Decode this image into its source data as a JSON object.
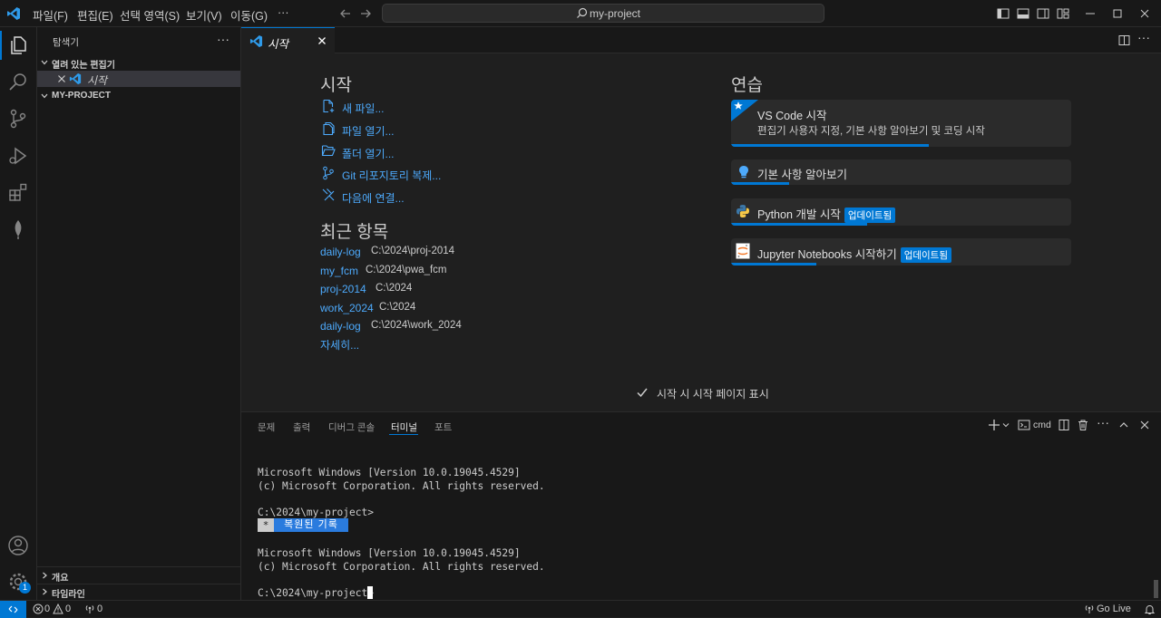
{
  "titlebar": {
    "menus": [
      "파일(F)",
      "편집(E)",
      "선택 영역(S)",
      "보기(V)",
      "이동(G)",
      "···"
    ],
    "command_center": "my-project"
  },
  "sidebar": {
    "title": "탐색기",
    "open_editors_label": "열려 있는 편집기",
    "open_editor_item": "시작",
    "project_label": "MY-PROJECT",
    "outline_label": "개요",
    "timeline_label": "타임라인"
  },
  "tabs": [
    {
      "label": "시작"
    }
  ],
  "welcome": {
    "start_heading": "시작",
    "start_links": [
      "새 파일...",
      "파일 열기...",
      "폴더 열기...",
      "Git 리포지토리 복제...",
      "다음에 연결..."
    ],
    "recent_heading": "최근 항목",
    "recent": [
      {
        "name": "daily-log",
        "path": "C:\\2024\\proj-2014"
      },
      {
        "name": "my_fcm",
        "path": "C:\\2024\\pwa_fcm"
      },
      {
        "name": "proj-2014",
        "path": "C:\\2024"
      },
      {
        "name": "work_2024",
        "path": "C:\\2024"
      },
      {
        "name": "daily-log",
        "path": "C:\\2024\\work_2024"
      }
    ],
    "more_link": "자세히...",
    "walkthrough_heading": "연습",
    "walkthroughs": [
      {
        "title": "VS Code 시작",
        "description": "편집기 사용자 지정, 기본 사항 알아보기 및 코딩 시작",
        "progress": 0.58
      },
      {
        "title": "기본 사항 알아보기",
        "progress": 0.17
      },
      {
        "title": "Python 개발 시작",
        "badge": "업데이트됨",
        "progress": 0.4
      },
      {
        "title": "Jupyter Notebooks 시작하기",
        "badge": "업데이트됨",
        "progress": 0.25
      }
    ],
    "show_on_startup": "시작 시 시작 페이지 표시"
  },
  "panel": {
    "tabs": [
      "문제",
      "출력",
      "디버그 콘솔",
      "터미널",
      "포트"
    ],
    "active_tab": "터미널",
    "shell": "cmd",
    "terminal": {
      "line1": "Microsoft Windows [Version 10.0.19045.4529]",
      "line2": "(c) Microsoft Corporation. All rights reserved.",
      "prompt1": "C:\\2024\\my-project>",
      "restored_star": "*",
      "restored_label": "복원된 기록",
      "line3": "Microsoft Windows [Version 10.0.19045.4529]",
      "line4": "(c) Microsoft Corporation. All rights reserved.",
      "prompt2": "C:\\2024\\my-project>"
    }
  },
  "statusbar": {
    "errors": "0",
    "warnings": "0",
    "ports": "0",
    "go_live": "Go Live"
  },
  "accounts_badge": "1",
  "colors": {
    "accent": "#0078d4",
    "link": "#4daafc",
    "background": "#1f1f1f",
    "chrome": "#181818"
  }
}
